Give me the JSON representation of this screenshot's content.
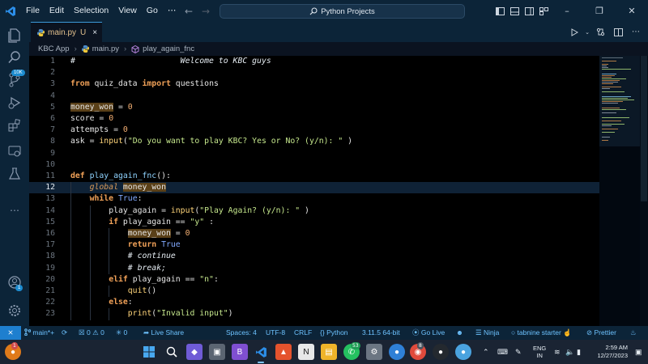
{
  "titlebar": {
    "menu": [
      "File",
      "Edit",
      "Selection",
      "View",
      "Go",
      "⋯"
    ],
    "search_text": "Python Projects"
  },
  "activity_bar": {
    "items": [
      "explorer-icon",
      "search-icon",
      "source-control-icon",
      "run-debug-icon",
      "extensions-icon",
      "remote-explorer-icon",
      "testing-icon",
      "more-icon",
      "account-icon",
      "settings-icon"
    ],
    "source_control_badge": "10K",
    "account_badge": "1"
  },
  "tab": {
    "filename": "main.py",
    "status": "U",
    "close": "×"
  },
  "breadcrumb": {
    "folder": "KBC App",
    "file": "main.py",
    "symbol": "play_again_fnc"
  },
  "editor": {
    "active_line": 12,
    "lines": [
      {
        "n": "1"
      },
      {
        "n": "2"
      },
      {
        "n": "3"
      },
      {
        "n": "4"
      },
      {
        "n": "5"
      },
      {
        "n": "6"
      },
      {
        "n": "7"
      },
      {
        "n": "8"
      },
      {
        "n": "9"
      },
      {
        "n": "10"
      },
      {
        "n": "11"
      },
      {
        "n": "12"
      },
      {
        "n": "13"
      },
      {
        "n": "14"
      },
      {
        "n": "15"
      },
      {
        "n": "16"
      },
      {
        "n": "17"
      },
      {
        "n": "18"
      },
      {
        "n": "19"
      },
      {
        "n": "20"
      },
      {
        "n": "21"
      },
      {
        "n": "22"
      },
      {
        "n": "23"
      }
    ],
    "tokens": {
      "l1_hash": "#",
      "l1_comment": "Welcome to KBC guys",
      "l3_from": "from",
      "l3_mod": "quiz_data",
      "l3_import": "import",
      "l3_name": "questions",
      "l5_var": "money_won",
      "l5_eq": " = ",
      "l5_val": "0",
      "l6_var": "score",
      "l6_eq": " = ",
      "l6_val": "0",
      "l7_var": "attempts",
      "l7_eq": " = ",
      "l7_val": "0",
      "l8_var": "ask",
      "l8_eq": " = ",
      "l8_fn": "input",
      "l8_open": "(",
      "l8_str": "\"Do you want to play KBC? Yes or No? (y/n): \"",
      "l8_close": " )",
      "l11_def": "def",
      "l11_fn": "play_again_fnc",
      "l11_rest": "():",
      "l12_global": "global",
      "l12_var": "money_won",
      "l13_while": "while",
      "l13_true": "True",
      "l13_colon": ":",
      "l14_var": "play_again",
      "l14_eq": " = ",
      "l14_fn": "input",
      "l14_open": "(",
      "l14_str": "\"Play Again? (y/n): \"",
      "l14_close": " )",
      "l15_if": "if",
      "l15_var": "play_again",
      "l15_op": " == ",
      "l15_str": "\"y\"",
      "l15_colon": " :",
      "l16_var": "money_won",
      "l16_eq": " = ",
      "l16_val": "0",
      "l17_return": "return",
      "l17_true": "True",
      "l18_cmt": "# continue",
      "l19_cmt": "# break;",
      "l20_elif": "elif",
      "l20_var": "play_again",
      "l20_op": " == ",
      "l20_str": "\"n\"",
      "l20_colon": ":",
      "l21_fn": "quit",
      "l21_rest": "()",
      "l22_else": "else",
      "l22_colon": ":",
      "l23_fn": "print",
      "l23_open": "(",
      "l23_str": "\"Invalid input\"",
      "l23_close": ")"
    }
  },
  "statusbar": {
    "remote": "⨯",
    "branch": "main*+",
    "errors": "0",
    "warnings": "0",
    "ports": "0",
    "live_share": "Live Share",
    "spaces": "Spaces: 4",
    "encoding": "UTF-8",
    "eol": "CRLF",
    "language": "Python",
    "interpreter": "3.11.5 64-bit",
    "go_live": "Go Live",
    "ninja": "Ninja",
    "tabnine": "tabnine starter",
    "prettier": "Prettier"
  },
  "taskbar": {
    "lang_top": "ENG",
    "lang_bottom": "IN",
    "time": "2:59 AM",
    "date": "12/27/2023",
    "whatsapp_badge": "53",
    "notify_badge": "1",
    "discord_badge": "8"
  },
  "colors": {
    "accent": "#3c9ad8",
    "titlebar_bg": "#0c2438",
    "editor_bg": "#000000",
    "keyword": "#f2a65a",
    "string": "#c6e88d",
    "function": "#8fd3ff"
  }
}
